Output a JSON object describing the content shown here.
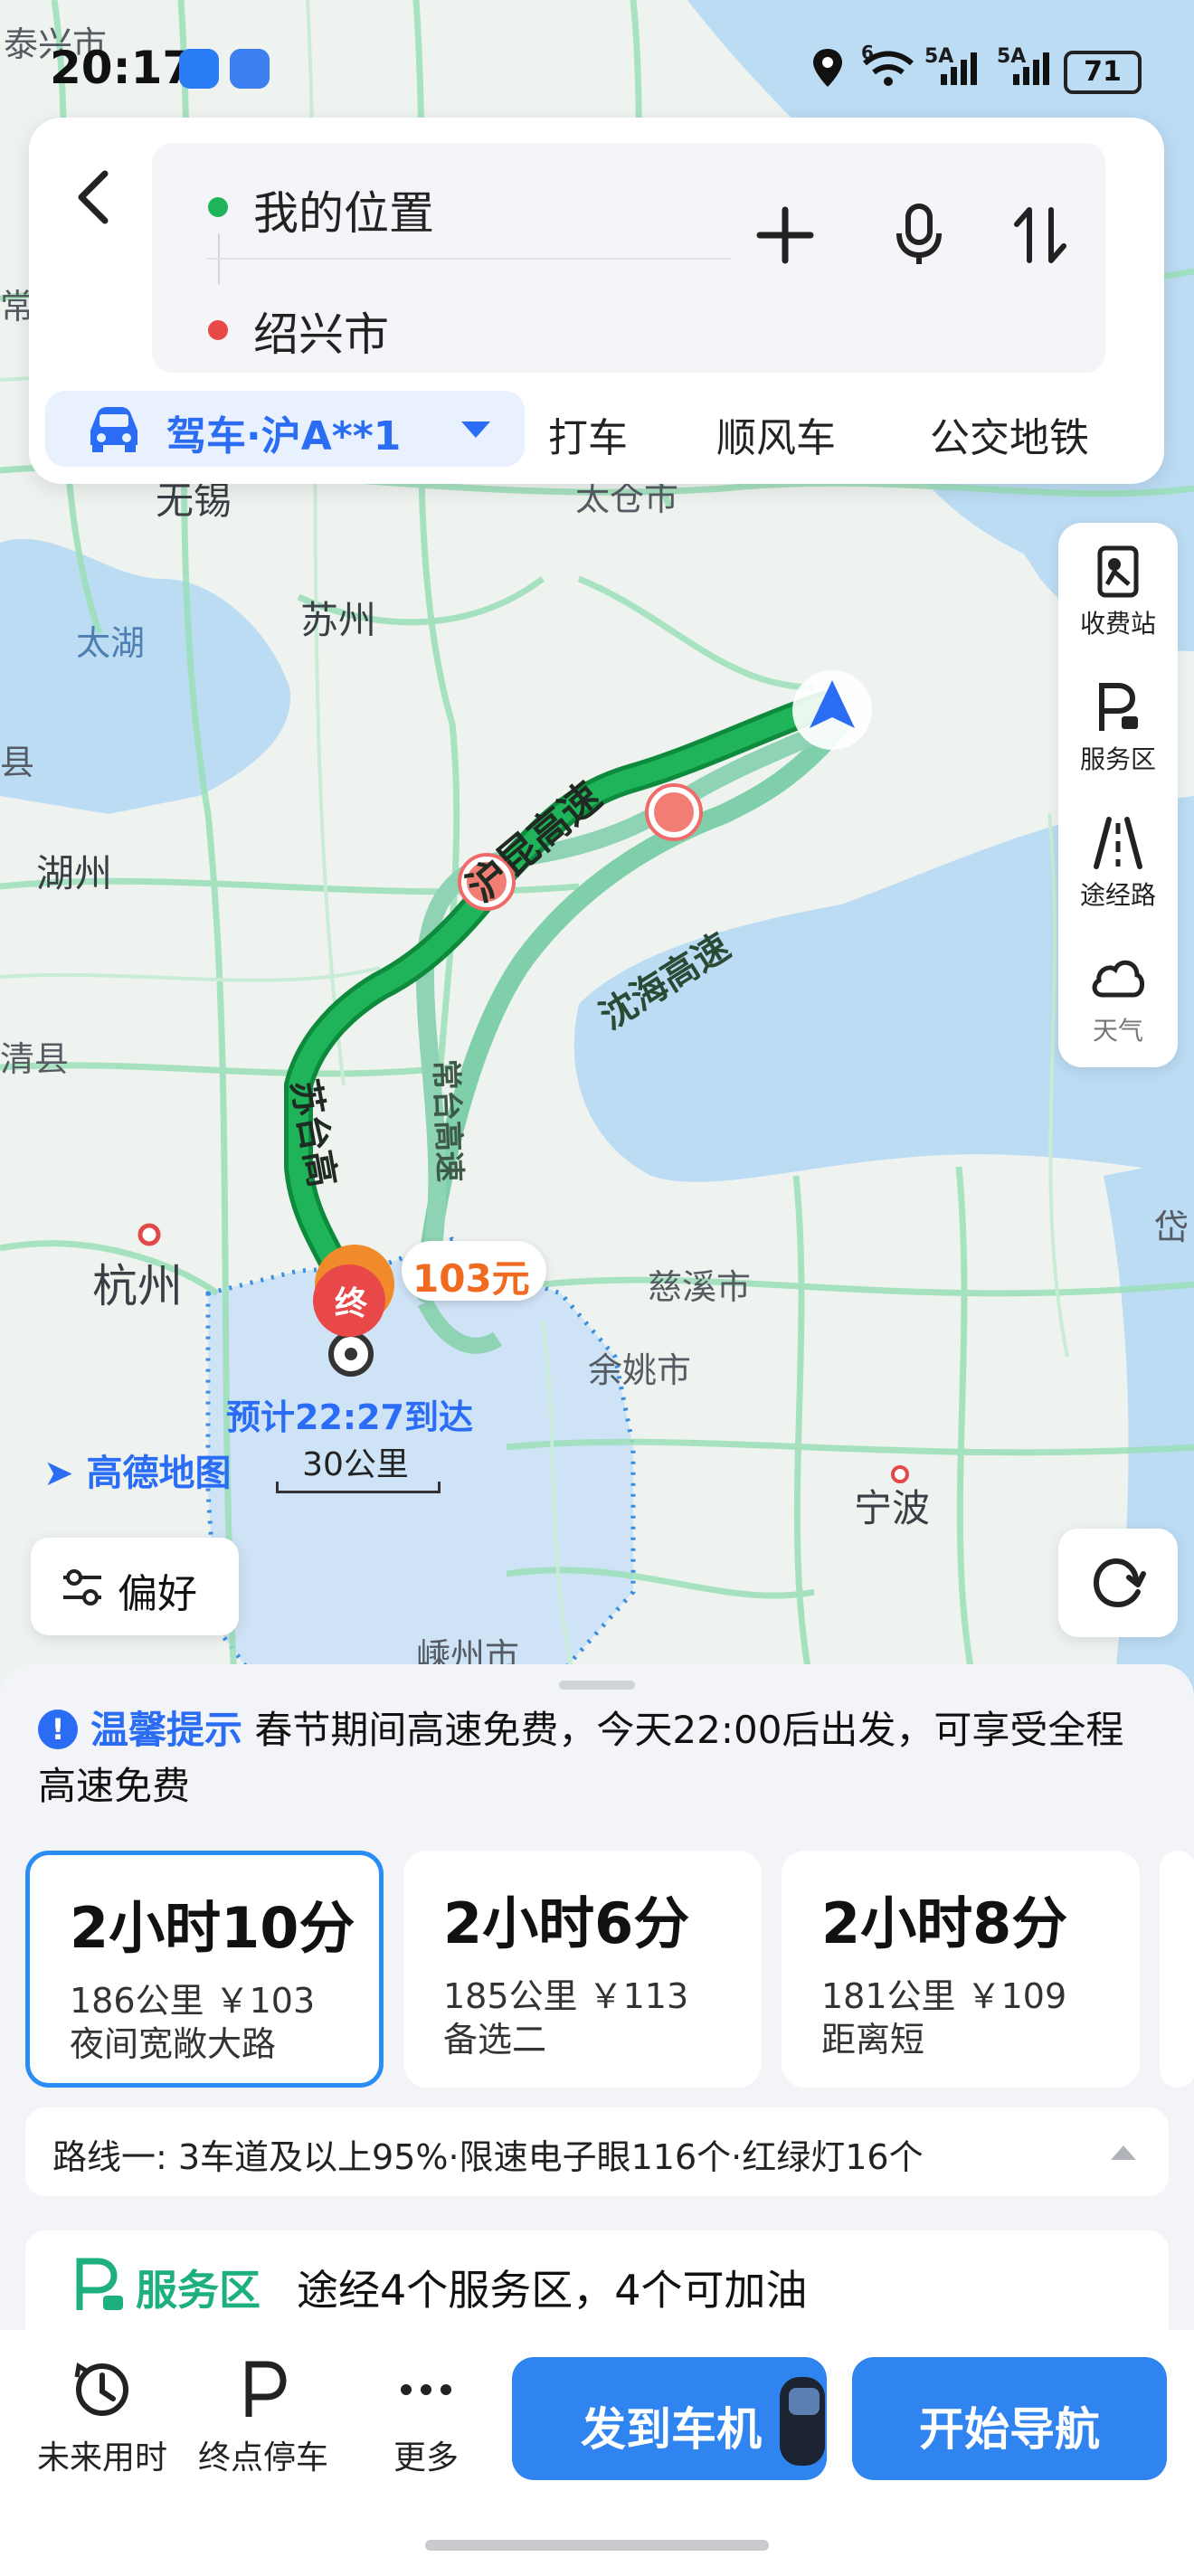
{
  "status_bar": {
    "time": "20:17",
    "signal_label_1": "5A",
    "signal_label_2": "5A",
    "wifi_label": "6",
    "battery": "71"
  },
  "search": {
    "origin": "我的位置",
    "destination": "绍兴市"
  },
  "modes": {
    "active": "驾车·沪A**1",
    "others": [
      "打车",
      "顺风车",
      "公交地铁"
    ]
  },
  "map": {
    "places": [
      "泰兴市",
      "无锡",
      "苏州",
      "太湖",
      "湖州",
      "杭州",
      "清县",
      "慈溪市",
      "余姚市",
      "宁波",
      "嵊州市",
      "太仓市",
      "常",
      "岱",
      "县"
    ],
    "roads": [
      "沪昆高速",
      "沈海高速",
      "常台高速",
      "苏台高"
    ],
    "price": "103元",
    "end_marker": "终",
    "eta": "预计22:27到达",
    "scale": "30公里",
    "logo": "高德地图"
  },
  "tools": [
    {
      "label": "收费站",
      "icon": "toll-station-icon"
    },
    {
      "label": "服务区",
      "icon": "service-area-icon"
    },
    {
      "label": "途经路",
      "icon": "route-road-icon"
    },
    {
      "label": "天气",
      "icon": "cloud-icon"
    }
  ],
  "preference_label": "偏好",
  "tip": {
    "title": "温馨提示",
    "text": "春节期间高速免费，今天22:00后出发，可享受全程高速免费"
  },
  "routes": [
    {
      "time": "2小时10分",
      "meta": "186公里  ￥103",
      "tag": "夜间宽敞大路",
      "selected": true
    },
    {
      "time": "2小时6分",
      "meta": "185公里  ￥113",
      "tag": "备选二",
      "selected": false
    },
    {
      "time": "2小时8分",
      "meta": "181公里  ￥109",
      "tag": "距离短",
      "selected": false
    }
  ],
  "route_info": "路线一:  3车道及以上95%·限速电子眼116个·红绿灯16个",
  "service": {
    "title": "服务区",
    "text": "途经4个服务区，4个可加油"
  },
  "bottom": {
    "future_time": "未来用时",
    "end_parking": "终点停车",
    "more": "更多",
    "send_to_car": "发到车机",
    "start_nav": "开始导航"
  },
  "colors": {
    "accent": "#2a6df4",
    "route_green": "#1fb45a",
    "price_orange": "#f06a1f",
    "service_green": "#1eaf80"
  }
}
